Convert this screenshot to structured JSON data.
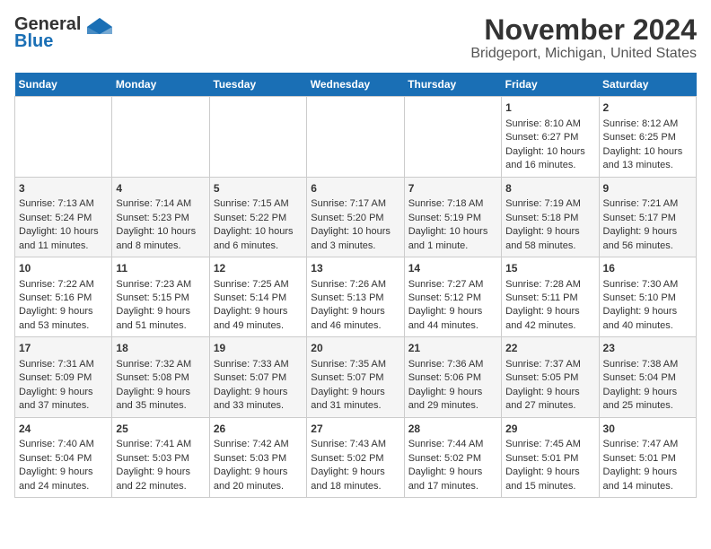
{
  "header": {
    "logo_line1": "General",
    "logo_line2": "Blue",
    "title": "November 2024",
    "subtitle": "Bridgeport, Michigan, United States"
  },
  "days_of_week": [
    "Sunday",
    "Monday",
    "Tuesday",
    "Wednesday",
    "Thursday",
    "Friday",
    "Saturday"
  ],
  "weeks": [
    [
      {
        "day": "",
        "empty": true
      },
      {
        "day": "",
        "empty": true
      },
      {
        "day": "",
        "empty": true
      },
      {
        "day": "",
        "empty": true
      },
      {
        "day": "",
        "empty": true
      },
      {
        "day": "1",
        "sunrise": "Sunrise: 8:10 AM",
        "sunset": "Sunset: 6:27 PM",
        "daylight": "Daylight: 10 hours and 16 minutes."
      },
      {
        "day": "2",
        "sunrise": "Sunrise: 8:12 AM",
        "sunset": "Sunset: 6:25 PM",
        "daylight": "Daylight: 10 hours and 13 minutes."
      }
    ],
    [
      {
        "day": "3",
        "sunrise": "Sunrise: 7:13 AM",
        "sunset": "Sunset: 5:24 PM",
        "daylight": "Daylight: 10 hours and 11 minutes."
      },
      {
        "day": "4",
        "sunrise": "Sunrise: 7:14 AM",
        "sunset": "Sunset: 5:23 PM",
        "daylight": "Daylight: 10 hours and 8 minutes."
      },
      {
        "day": "5",
        "sunrise": "Sunrise: 7:15 AM",
        "sunset": "Sunset: 5:22 PM",
        "daylight": "Daylight: 10 hours and 6 minutes."
      },
      {
        "day": "6",
        "sunrise": "Sunrise: 7:17 AM",
        "sunset": "Sunset: 5:20 PM",
        "daylight": "Daylight: 10 hours and 3 minutes."
      },
      {
        "day": "7",
        "sunrise": "Sunrise: 7:18 AM",
        "sunset": "Sunset: 5:19 PM",
        "daylight": "Daylight: 10 hours and 1 minute."
      },
      {
        "day": "8",
        "sunrise": "Sunrise: 7:19 AM",
        "sunset": "Sunset: 5:18 PM",
        "daylight": "Daylight: 9 hours and 58 minutes."
      },
      {
        "day": "9",
        "sunrise": "Sunrise: 7:21 AM",
        "sunset": "Sunset: 5:17 PM",
        "daylight": "Daylight: 9 hours and 56 minutes."
      }
    ],
    [
      {
        "day": "10",
        "sunrise": "Sunrise: 7:22 AM",
        "sunset": "Sunset: 5:16 PM",
        "daylight": "Daylight: 9 hours and 53 minutes."
      },
      {
        "day": "11",
        "sunrise": "Sunrise: 7:23 AM",
        "sunset": "Sunset: 5:15 PM",
        "daylight": "Daylight: 9 hours and 51 minutes."
      },
      {
        "day": "12",
        "sunrise": "Sunrise: 7:25 AM",
        "sunset": "Sunset: 5:14 PM",
        "daylight": "Daylight: 9 hours and 49 minutes."
      },
      {
        "day": "13",
        "sunrise": "Sunrise: 7:26 AM",
        "sunset": "Sunset: 5:13 PM",
        "daylight": "Daylight: 9 hours and 46 minutes."
      },
      {
        "day": "14",
        "sunrise": "Sunrise: 7:27 AM",
        "sunset": "Sunset: 5:12 PM",
        "daylight": "Daylight: 9 hours and 44 minutes."
      },
      {
        "day": "15",
        "sunrise": "Sunrise: 7:28 AM",
        "sunset": "Sunset: 5:11 PM",
        "daylight": "Daylight: 9 hours and 42 minutes."
      },
      {
        "day": "16",
        "sunrise": "Sunrise: 7:30 AM",
        "sunset": "Sunset: 5:10 PM",
        "daylight": "Daylight: 9 hours and 40 minutes."
      }
    ],
    [
      {
        "day": "17",
        "sunrise": "Sunrise: 7:31 AM",
        "sunset": "Sunset: 5:09 PM",
        "daylight": "Daylight: 9 hours and 37 minutes."
      },
      {
        "day": "18",
        "sunrise": "Sunrise: 7:32 AM",
        "sunset": "Sunset: 5:08 PM",
        "daylight": "Daylight: 9 hours and 35 minutes."
      },
      {
        "day": "19",
        "sunrise": "Sunrise: 7:33 AM",
        "sunset": "Sunset: 5:07 PM",
        "daylight": "Daylight: 9 hours and 33 minutes."
      },
      {
        "day": "20",
        "sunrise": "Sunrise: 7:35 AM",
        "sunset": "Sunset: 5:07 PM",
        "daylight": "Daylight: 9 hours and 31 minutes."
      },
      {
        "day": "21",
        "sunrise": "Sunrise: 7:36 AM",
        "sunset": "Sunset: 5:06 PM",
        "daylight": "Daylight: 9 hours and 29 minutes."
      },
      {
        "day": "22",
        "sunrise": "Sunrise: 7:37 AM",
        "sunset": "Sunset: 5:05 PM",
        "daylight": "Daylight: 9 hours and 27 minutes."
      },
      {
        "day": "23",
        "sunrise": "Sunrise: 7:38 AM",
        "sunset": "Sunset: 5:04 PM",
        "daylight": "Daylight: 9 hours and 25 minutes."
      }
    ],
    [
      {
        "day": "24",
        "sunrise": "Sunrise: 7:40 AM",
        "sunset": "Sunset: 5:04 PM",
        "daylight": "Daylight: 9 hours and 24 minutes."
      },
      {
        "day": "25",
        "sunrise": "Sunrise: 7:41 AM",
        "sunset": "Sunset: 5:03 PM",
        "daylight": "Daylight: 9 hours and 22 minutes."
      },
      {
        "day": "26",
        "sunrise": "Sunrise: 7:42 AM",
        "sunset": "Sunset: 5:03 PM",
        "daylight": "Daylight: 9 hours and 20 minutes."
      },
      {
        "day": "27",
        "sunrise": "Sunrise: 7:43 AM",
        "sunset": "Sunset: 5:02 PM",
        "daylight": "Daylight: 9 hours and 18 minutes."
      },
      {
        "day": "28",
        "sunrise": "Sunrise: 7:44 AM",
        "sunset": "Sunset: 5:02 PM",
        "daylight": "Daylight: 9 hours and 17 minutes."
      },
      {
        "day": "29",
        "sunrise": "Sunrise: 7:45 AM",
        "sunset": "Sunset: 5:01 PM",
        "daylight": "Daylight: 9 hours and 15 minutes."
      },
      {
        "day": "30",
        "sunrise": "Sunrise: 7:47 AM",
        "sunset": "Sunset: 5:01 PM",
        "daylight": "Daylight: 9 hours and 14 minutes."
      }
    ]
  ]
}
